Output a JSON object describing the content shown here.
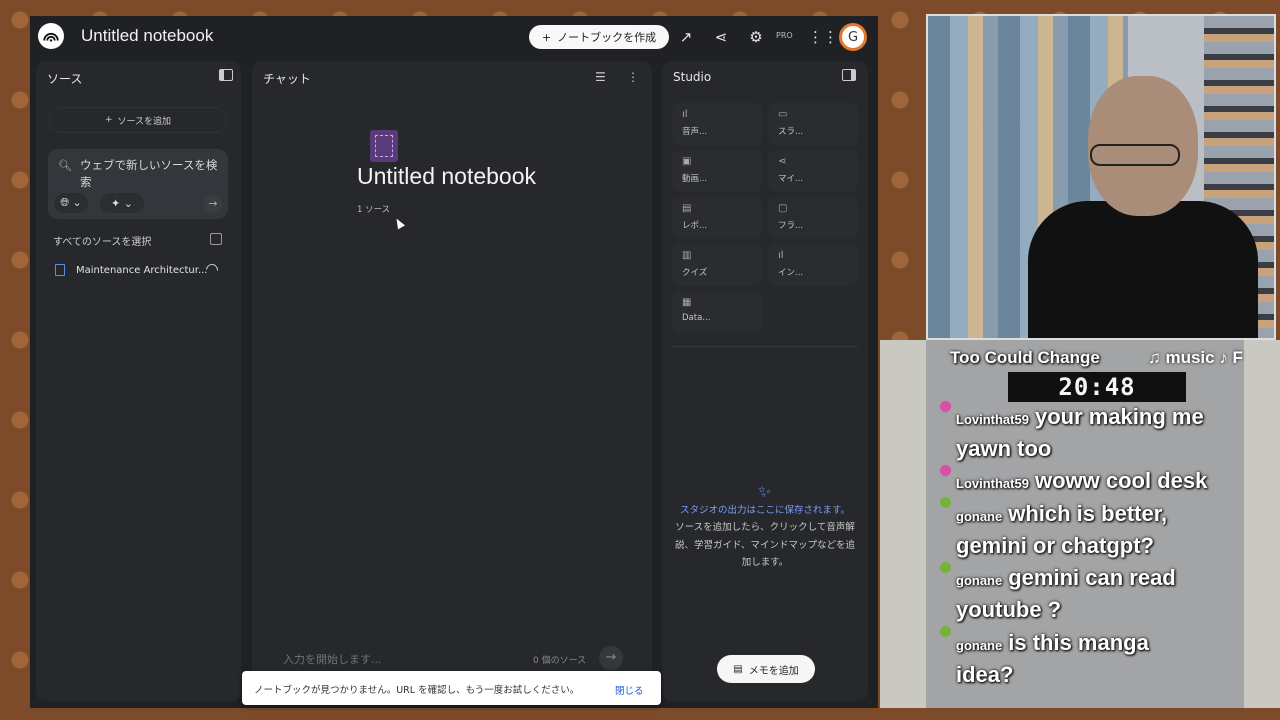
{
  "app": {
    "title": "Untitled notebook",
    "create_button": "ノートブックを作成",
    "pro_label": "PRO"
  },
  "sources": {
    "heading": "ソース",
    "add_button": "ソースを追加",
    "search_placeholder": "ウェブで新しいソースを検索",
    "select_all": "すべてのソースを選択",
    "items": [
      {
        "name": "Maintenance Architectur..."
      }
    ]
  },
  "chat": {
    "heading": "チャット",
    "notebook_title": "Untitled notebook",
    "source_count": "1 ソース",
    "input_placeholder": "入力を開始します...",
    "input_source_count": "0 個のソース"
  },
  "studio": {
    "heading": "Studio",
    "tiles": [
      {
        "label": "音声..."
      },
      {
        "label": "スラ..."
      },
      {
        "label": "動画..."
      },
      {
        "label": "マイ..."
      },
      {
        "label": "レポ..."
      },
      {
        "label": "フラ..."
      },
      {
        "label": "クイズ"
      },
      {
        "label": "イン..."
      },
      {
        "label": "Data..."
      }
    ],
    "highlight": "スタジオの出力はここに保存されます。",
    "description": "ソースを追加したら、クリックして音声解説、学習ガイド、マインドマップなどを追加します。",
    "memo_button": "メモを追加"
  },
  "toast": {
    "message": "ノートブックが見つかりません。URL を確認し、もう一度お試しください。",
    "close": "閉じる"
  },
  "stream": {
    "song": "Too Could Change",
    "music": "♫ music ♪ F",
    "clock": "20:48",
    "messages": [
      {
        "user": "Lovinthat59",
        "text": "your making me",
        "cont": "yawn too"
      },
      {
        "user": "Lovinthat59",
        "text": "woww cool desk",
        "cont": ""
      },
      {
        "user": "gonane",
        "text": "which is better,",
        "cont": "gemini or chatgpt?"
      },
      {
        "user": "gonane",
        "text": "gemini can read",
        "cont": "youtube ?"
      },
      {
        "user": "gonane",
        "text": "is this manga",
        "cont": "idea?"
      }
    ]
  },
  "colors": {
    "app_bg": "#1f2124",
    "panel_bg": "#26282c",
    "accent_blue": "#7c9cf3",
    "link_blue": "#1a57d6"
  }
}
